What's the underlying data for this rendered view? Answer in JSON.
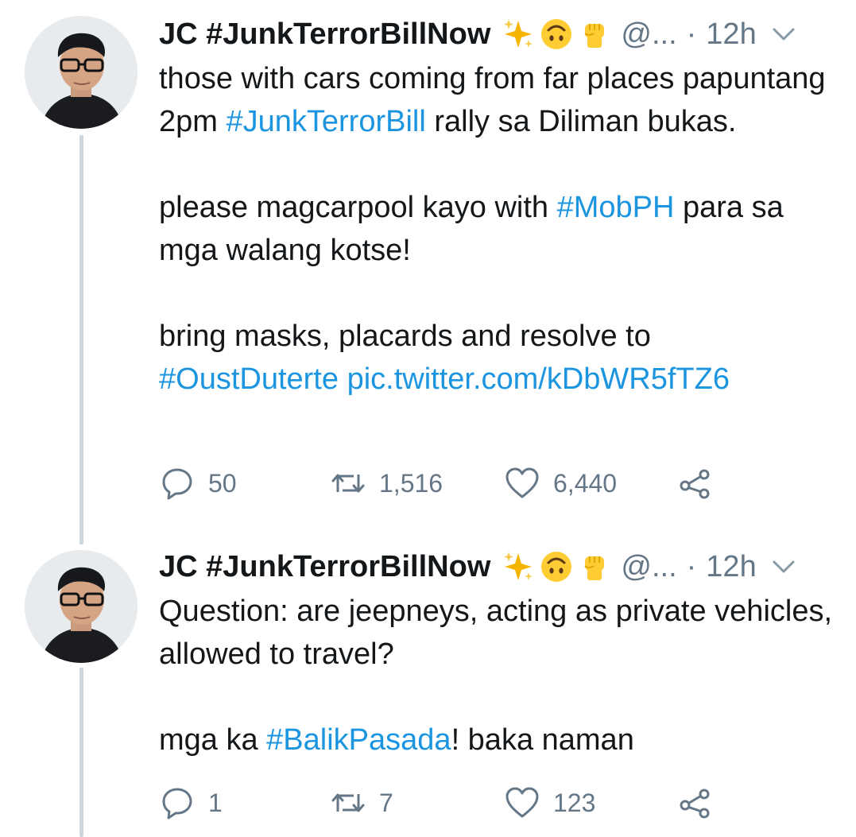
{
  "tweets": [
    {
      "author": {
        "name": "JC #JunkTerrorBillNow",
        "handle": "@...",
        "emojis": [
          "sparkles-icon",
          "upside-down-face-icon",
          "raised-fist-icon"
        ]
      },
      "time": "12h",
      "separator": "·",
      "body": [
        [
          {
            "text": "those with cars coming from far places papuntang 2pm "
          },
          {
            "text": "#JunkTerrorBill",
            "link": true
          },
          {
            "text": " rally sa Diliman bukas."
          }
        ],
        [
          {
            "text": "please magcarpool kayo with "
          },
          {
            "text": "#MobPH",
            "link": true
          },
          {
            "text": " para sa mga walang kotse!"
          }
        ],
        [
          {
            "text": "bring masks, placards and resolve to "
          },
          {
            "text": "#OustDuterte",
            "link": true
          },
          {
            "text": " "
          },
          {
            "text": "pic.twitter.com/kDbWR5fTZ6",
            "link": true
          }
        ]
      ],
      "stats": {
        "replies": "50",
        "retweets": "1,516",
        "likes": "6,440"
      }
    },
    {
      "author": {
        "name": "JC #JunkTerrorBillNow",
        "handle": "@...",
        "emojis": [
          "sparkles-icon",
          "upside-down-face-icon",
          "raised-fist-icon"
        ]
      },
      "time": "12h",
      "separator": "·",
      "body": [
        [
          {
            "text": "Question: are jeepneys, acting as private vehicles, allowed to travel?"
          }
        ],
        [
          {
            "text": "mga ka "
          },
          {
            "text": "#BalikPasada",
            "link": true
          },
          {
            "text": "! baka naman"
          }
        ]
      ],
      "stats": {
        "replies": "1",
        "retweets": "7",
        "likes": "123"
      }
    }
  ],
  "colors": {
    "link": "#1b95e0",
    "secondary": "#657786",
    "thread_line": "#ccd6dd",
    "text": "#14171a"
  }
}
